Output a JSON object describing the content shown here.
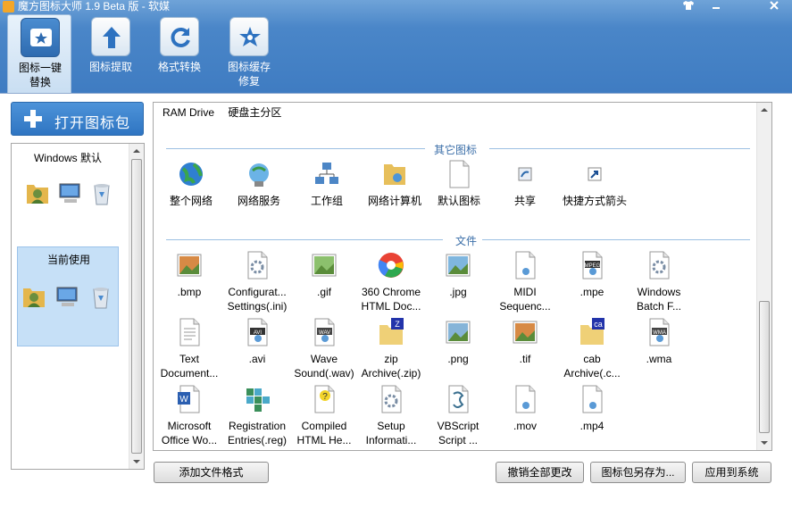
{
  "window": {
    "title": "魔方图标大师 1.9 Beta 版 - 软媒",
    "controls": [
      "shirt-icon",
      "minimize-icon",
      "close-icon"
    ]
  },
  "toolbar": [
    {
      "label": "图标一键替换",
      "icon": "star-icon",
      "active": true
    },
    {
      "label": "图标提取",
      "icon": "arrow-up-icon",
      "active": false
    },
    {
      "label": "格式转换",
      "icon": "refresh-icon",
      "active": false
    },
    {
      "label": "图标缓存修复",
      "icon": "wrench-star-icon",
      "active": false
    }
  ],
  "left": {
    "open_button": "打开图标包",
    "themes": [
      {
        "name": "Windows 默认",
        "selected": false
      },
      {
        "name": "当前使用",
        "selected": true
      }
    ]
  },
  "drives": [
    "RAM Drive",
    "硬盘主分区"
  ],
  "sections": {
    "other": {
      "title": "其它图标",
      "items": [
        {
          "label": "整个网络",
          "icon": "globe-icon"
        },
        {
          "label": "网络服务",
          "icon": "network-service-icon"
        },
        {
          "label": "工作组",
          "icon": "workgroup-icon"
        },
        {
          "label": "网络计算机",
          "icon": "network-folder-icon"
        },
        {
          "label": "默认图标",
          "icon": "blank-file-icon"
        },
        {
          "label": "共享",
          "icon": "share-icon"
        },
        {
          "label": "快捷方式箭头",
          "icon": "shortcut-arrow-icon"
        }
      ]
    },
    "files": {
      "title": "文件",
      "items": [
        {
          "label": ".bmp",
          "icon": "bmp-file-icon"
        },
        {
          "label": "Configurat... Settings(.ini)",
          "icon": "ini-file-icon"
        },
        {
          "label": ".gif",
          "icon": "gif-file-icon"
        },
        {
          "label": "360 Chrome HTML Doc...",
          "icon": "chrome-icon"
        },
        {
          "label": ".jpg",
          "icon": "jpg-file-icon"
        },
        {
          "label": "MIDI Sequenc...",
          "icon": "midi-file-icon"
        },
        {
          "label": ".mpe",
          "icon": "mpeg-file-icon"
        },
        {
          "label": "Windows Batch F...",
          "icon": "batch-file-icon"
        },
        {
          "label": "Text Document...",
          "icon": "text-file-icon"
        },
        {
          "label": ".avi",
          "icon": "avi-file-icon"
        },
        {
          "label": "Wave Sound(.wav)",
          "icon": "wav-file-icon"
        },
        {
          "label": "zip Archive(.zip)",
          "icon": "zip-folder-icon"
        },
        {
          "label": ".png",
          "icon": "png-file-icon"
        },
        {
          "label": ".tif",
          "icon": "tif-file-icon"
        },
        {
          "label": "cab Archive(.c...",
          "icon": "cab-folder-icon"
        },
        {
          "label": ".wma",
          "icon": "wma-file-icon"
        },
        {
          "label": "Microsoft Office Wo...",
          "icon": "word-file-icon"
        },
        {
          "label": "Registration Entries(.reg)",
          "icon": "reg-file-icon"
        },
        {
          "label": "Compiled HTML He...",
          "icon": "chm-file-icon"
        },
        {
          "label": "Setup Informati...",
          "icon": "setup-file-icon"
        },
        {
          "label": "VBScript Script ...",
          "icon": "vbs-file-icon"
        },
        {
          "label": ".mov",
          "icon": "mov-file-icon"
        },
        {
          "label": ".mp4",
          "icon": "mp4-file-icon"
        }
      ]
    }
  },
  "bottom": {
    "add_format": "添加文件格式",
    "undo_all": "撤销全部更改",
    "save_as": "图标包另存为...",
    "apply": "应用到系统"
  },
  "colors": {
    "accent": "#3f7cc2",
    "selection": "#c6e0f7",
    "section_title": "#3a6ea8"
  }
}
